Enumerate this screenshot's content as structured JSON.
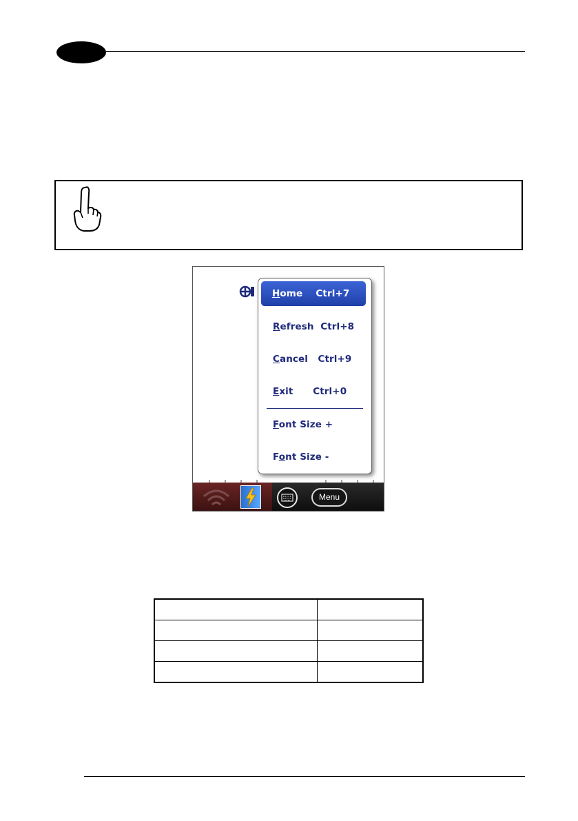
{
  "header": {
    "chapter_number": ""
  },
  "note": {
    "text": ""
  },
  "screenshot": {
    "popup_menu": {
      "items": [
        {
          "label": "Home",
          "accel": "H",
          "shortcut": "Ctrl+7",
          "selected": true
        },
        {
          "label": "Refresh",
          "accel": "R",
          "shortcut": "Ctrl+8",
          "selected": false
        },
        {
          "label": "Cancel",
          "accel": "C",
          "shortcut": "Ctrl+9",
          "selected": false
        },
        {
          "label": "Exit",
          "accel": "E",
          "shortcut": "Ctrl+0",
          "selected": false
        },
        {
          "label": "Font Size +",
          "accel": "F",
          "shortcut": "",
          "selected": false
        },
        {
          "label": "Font Size -",
          "accel": "o",
          "shortcut": "",
          "selected": false
        }
      ]
    },
    "taskbar": {
      "menu_label": "Menu"
    }
  },
  "table": {
    "rows": [
      [
        "",
        ""
      ],
      [
        "",
        ""
      ],
      [
        "",
        ""
      ],
      [
        "",
        ""
      ]
    ]
  },
  "colors": {
    "menu_text": "#1f2a7a",
    "menu_highlight": "#2a4fc4"
  }
}
